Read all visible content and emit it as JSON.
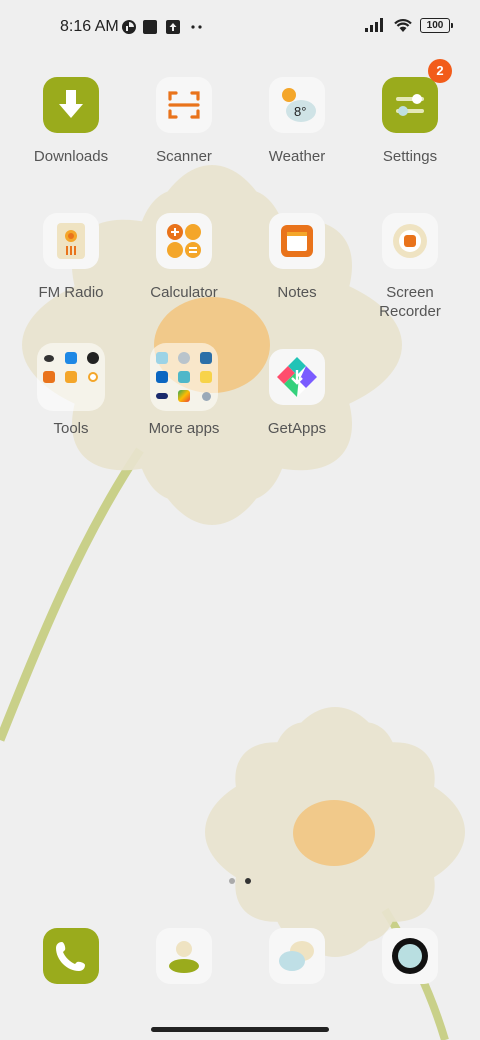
{
  "status_bar": {
    "time": "8:16 AM",
    "battery": "100",
    "icons": [
      "data-saver-icon",
      "square-notification-icon",
      "upload-notification-icon",
      "more-dots-icon",
      "signal-icon",
      "wifi-icon",
      "battery-icon"
    ]
  },
  "apps": [
    {
      "label": "Downloads",
      "icon": "download-arrow-icon"
    },
    {
      "label": "Scanner",
      "icon": "scan-frame-icon"
    },
    {
      "label": "Weather",
      "icon": "sun-cloud-icon",
      "temp": "8°"
    },
    {
      "label": "Settings",
      "icon": "sliders-icon",
      "badge": "2"
    },
    {
      "label": "FM Radio",
      "icon": "radio-icon"
    },
    {
      "label": "Calculator",
      "icon": "calculator-icon"
    },
    {
      "label": "Notes",
      "icon": "notes-icon"
    },
    {
      "label": "Screen Recorder",
      "icon": "record-icon"
    },
    {
      "label": "Tools",
      "icon": "folder-icon"
    },
    {
      "label": "More apps",
      "icon": "folder-icon"
    },
    {
      "label": "GetApps",
      "icon": "getapps-icon"
    }
  ],
  "dock": [
    {
      "icon": "phone-icon"
    },
    {
      "icon": "contacts-icon"
    },
    {
      "icon": "messages-icon"
    },
    {
      "icon": "camera-icon"
    }
  ],
  "page_indicator": {
    "pages": 2,
    "current": 2
  },
  "colors": {
    "accent_olive": "#9aab1c",
    "accent_orange": "#e9731b",
    "badge": "#f25c1a",
    "background": "#efefef"
  }
}
